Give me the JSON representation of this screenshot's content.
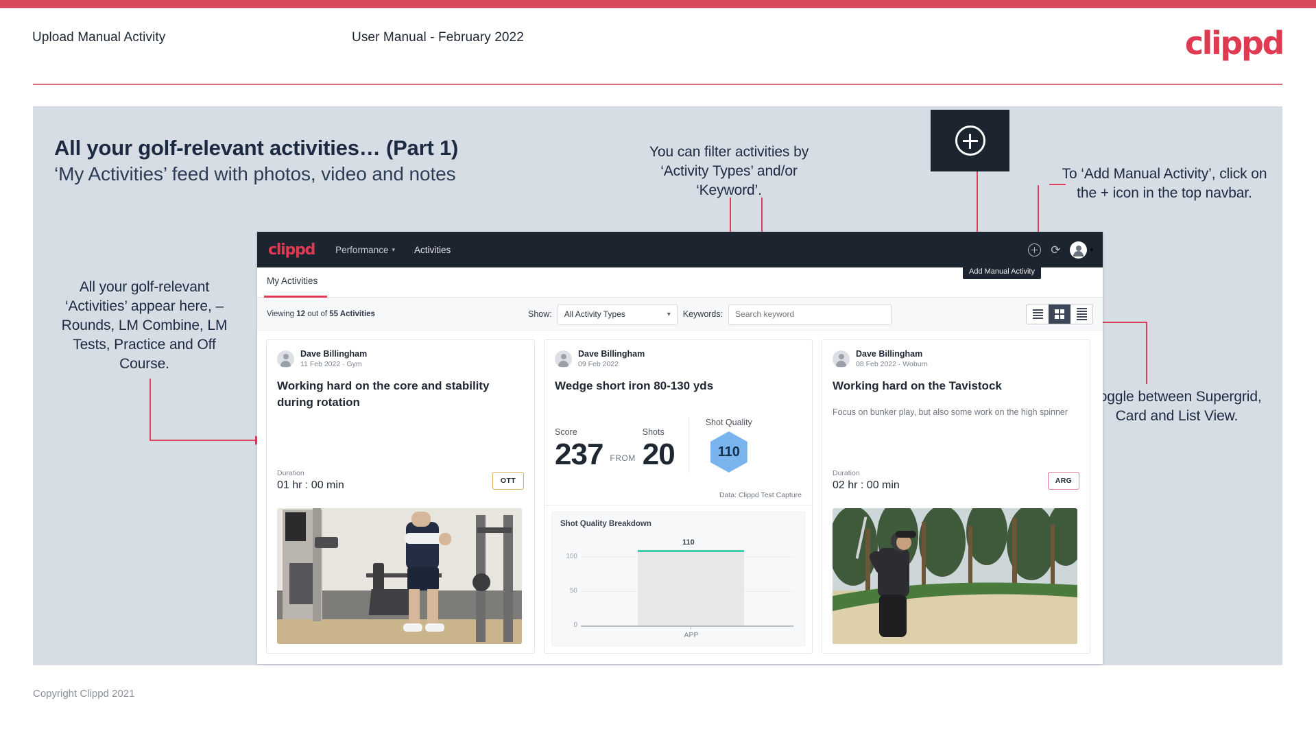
{
  "slide_header": {
    "left_title": "Upload Manual Activity",
    "center_title": "User Manual - February 2022",
    "logo": "clippd"
  },
  "slide": {
    "title": "All your golf-relevant activities… (Part 1)",
    "subtitle": "‘My Activities’ feed with photos, video and notes",
    "plus_icon": "plus-circle-icon"
  },
  "annotations": {
    "filter": "You can filter activities by ‘Activity Types’ and/or ‘Keyword’.",
    "add_manual": "To ‘Add Manual Activity’, click on the + icon in the top navbar.",
    "activities": "All your golf-relevant ‘Activities’ appear here, – Rounds, LM Combine, LM Tests, Practice and Off Course.",
    "toggle": "Toggle between Supergrid, Card and List View."
  },
  "app": {
    "navbar": {
      "logo": "clippd",
      "links": [
        {
          "label": "Performance",
          "has_caret": true
        },
        {
          "label": "Activities",
          "has_caret": false
        }
      ],
      "icons": [
        "add-circle-icon",
        "refresh-icon",
        "account-avatar-icon",
        "chevron-down-icon"
      ],
      "tooltip": "Add Manual Activity"
    },
    "tabs": [
      {
        "label": "My Activities",
        "active": true
      }
    ],
    "filterbar": {
      "viewing_prefix": "Viewing ",
      "viewing_count": "12",
      "viewing_mid": " out of ",
      "viewing_total": "55 Activities",
      "show_label": "Show:",
      "show_value": "All Activity Types",
      "keywords_label": "Keywords:",
      "keywords_placeholder": "Search keyword",
      "keywords_value": "",
      "view_toggles": [
        {
          "name": "list-view",
          "active": false
        },
        {
          "name": "supergrid-view",
          "active": true
        },
        {
          "name": "card-view",
          "active": false
        }
      ]
    },
    "cards": [
      {
        "user": "Dave Billingham",
        "meta": "11 Feb 2022 · Gym",
        "title": "Working hard on the core and stability during rotation",
        "note": "",
        "duration_label": "Duration",
        "duration_value": "01 hr : 00 min",
        "chip": "OTT",
        "chip_style": "ott",
        "media": "gym-video-thumbnail"
      },
      {
        "user": "Dave Billingham",
        "meta": "09 Feb 2022",
        "title": "Wedge short iron 80-130 yds",
        "score_label": "Score",
        "score_value": "237",
        "from_label": "FROM",
        "shots_label": "Shots",
        "shots_value": "20",
        "shot_quality_label": "Shot Quality",
        "shot_quality_value": "110",
        "data_source": "Data: Clippd Test Capture"
      },
      {
        "user": "Dave Billingham",
        "meta": "08 Feb 2022 · Woburn",
        "title": "Working hard on the Tavistock",
        "note": "Focus on bunker play, but also some work on the high spinner",
        "duration_label": "Duration",
        "duration_value": "02 hr : 00 min",
        "chip": "ARG",
        "chip_style": "arg",
        "media": "bunker-shot-thumbnail"
      }
    ]
  },
  "chart_data": {
    "type": "bar",
    "title": "Shot Quality Breakdown",
    "categories": [
      "APP"
    ],
    "values": [
      110
    ],
    "labels": [
      "110"
    ],
    "xlabel": "",
    "ylabel": "",
    "ylim": [
      0,
      120
    ],
    "yticks": [
      0,
      50,
      100
    ],
    "ytick_labels": [
      "0",
      "50",
      "100"
    ],
    "grid": true,
    "legend": false,
    "bar_color": "#e6e7e9",
    "bar_top_color": "#3ec9a7"
  },
  "footer": {
    "copyright": "Copyright Clippd 2021"
  }
}
